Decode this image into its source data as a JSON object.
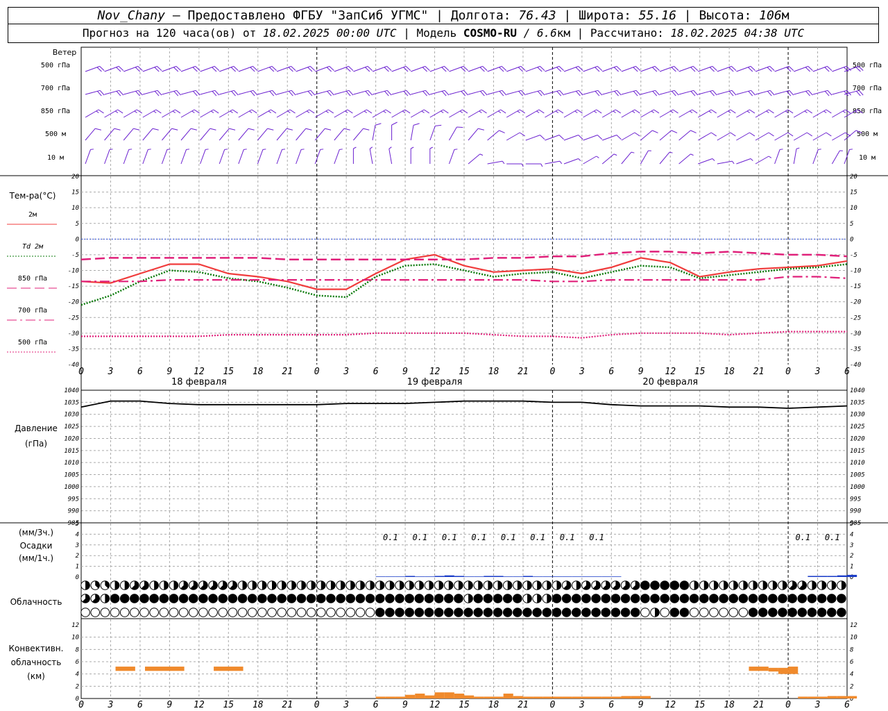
{
  "header": {
    "station": "Nov_Chany",
    "sep1": " — ",
    "provider": "Предоставлено ФГБУ \"ЗапСиб УГМС\"",
    "sep2": " | ",
    "lon_label": "Долгота: ",
    "lon_value": "76.43",
    "lat_label": "Широта: ",
    "lat_value": "55.16",
    "alt_label": "Высота: ",
    "alt_value": "106",
    "alt_unit": "м"
  },
  "subheader": {
    "forecast_label": "Прогноз на 120 часа(ов) от ",
    "forecast_start": "18.02.2025 00:00 UTC",
    "model_label": " | Модель ",
    "model_name": "COSMO-RU",
    "model_res": " / 6.6",
    "model_unit": "км",
    "calc_label": " | Рассчитано: ",
    "calc_time": "18.02.2025 04:38 UTC"
  },
  "colors": {
    "wind": "#6a1fd0",
    "t2m": "#f03c3c",
    "td2m": "#0a7a0a",
    "p850": "#e0207a",
    "p700": "#e0207a",
    "p500": "#e0207a",
    "zero_line": "#3050e0",
    "pressure": "#000000",
    "precip": "#1a3cc8",
    "convective": "#f08a2c",
    "grid": "#aaaaaa"
  },
  "chart_data": [
    {
      "type": "wind-barbs",
      "panel_label": "Ветер",
      "levels": [
        "500 гПа",
        "700 гПа",
        "850 гПа",
        "500  м",
        "10   м"
      ],
      "rows": [
        {
          "spd": 20,
          "dir": [
            250,
            250,
            250,
            250,
            250,
            250,
            250,
            250,
            250,
            250,
            250,
            250,
            250,
            250,
            250,
            250,
            250,
            250,
            250,
            250,
            250,
            250,
            250,
            250,
            250,
            250,
            250,
            250,
            250,
            250,
            250,
            250,
            250,
            250,
            250,
            250,
            250,
            250,
            250,
            250,
            250
          ]
        },
        {
          "spd": 20,
          "dir": [
            255,
            255,
            255,
            255,
            255,
            255,
            255,
            255,
            255,
            255,
            255,
            255,
            255,
            255,
            255,
            255,
            255,
            255,
            255,
            255,
            255,
            255,
            255,
            255,
            255,
            255,
            255,
            255,
            255,
            255,
            255,
            255,
            255,
            255,
            255,
            255,
            255,
            255,
            255,
            255,
            255
          ]
        },
        {
          "spd": 15,
          "dir": [
            240,
            240,
            240,
            240,
            240,
            240,
            240,
            240,
            240,
            240,
            240,
            240,
            240,
            240,
            240,
            240,
            240,
            240,
            240,
            240,
            240,
            240,
            240,
            240,
            240,
            240,
            240,
            240,
            240,
            240,
            240,
            240,
            240,
            240,
            240,
            240,
            240,
            240,
            240,
            240,
            240
          ]
        },
        {
          "spd": 10,
          "dir": [
            220,
            220,
            220,
            220,
            220,
            220,
            220,
            220,
            220,
            220,
            220,
            220,
            220,
            220,
            220,
            190,
            180,
            190,
            200,
            210,
            220,
            230,
            240,
            250,
            250,
            250,
            250,
            250,
            240,
            230,
            230,
            230,
            240,
            240,
            240,
            240,
            240,
            240,
            240,
            240,
            230
          ]
        },
        {
          "spd": 5,
          "dir": [
            200,
            200,
            200,
            200,
            200,
            200,
            200,
            200,
            200,
            200,
            200,
            200,
            200,
            200,
            180,
            170,
            170,
            180,
            180,
            200,
            230,
            260,
            270,
            270,
            260,
            250,
            240,
            230,
            220,
            210,
            220,
            230,
            250,
            260,
            250,
            240,
            200,
            190,
            200,
            210,
            200
          ]
        }
      ]
    },
    {
      "type": "line",
      "ylabel": "Тем-ра(°С)",
      "ylim": [
        -40,
        20
      ],
      "x_unit": "hours",
      "x": [
        0,
        3,
        6,
        9,
        12,
        15,
        18,
        21,
        24,
        27,
        30,
        33,
        36,
        39,
        42,
        45,
        48,
        51,
        54,
        57,
        60,
        63,
        66,
        69,
        72,
        75,
        78
      ],
      "x_tick_labels": [
        "0",
        "3",
        "6",
        "9",
        "12",
        "15",
        "18",
        "21",
        "0",
        "3",
        "6",
        "9",
        "12",
        "15",
        "18",
        "21",
        "0",
        "3",
        "6",
        "9",
        "12",
        "15",
        "18",
        "21",
        "0",
        "3",
        "6"
      ],
      "date_labels": [
        "18 февраля",
        "19 февраля",
        "20 февраля"
      ],
      "date_label_x": [
        12,
        36,
        60
      ],
      "series": [
        {
          "name": "2м",
          "style": "solid",
          "values": [
            -13.5,
            -14,
            -11,
            -8,
            -8,
            -11,
            -12,
            -13.5,
            -16,
            -16,
            -11,
            -6.5,
            -5,
            -8.5,
            -10.5,
            -10,
            -9.5,
            -11,
            -9,
            -6,
            -7.5,
            -12,
            -10.5,
            -9.5,
            -9,
            -8.5,
            -7
          ]
        },
        {
          "name": "Td 2м",
          "style": "dotted",
          "values": [
            -21,
            -18,
            -13.5,
            -10,
            -10.5,
            -12.5,
            -13.5,
            -15.5,
            -18,
            -18.5,
            -12,
            -8.5,
            -8,
            -10,
            -12,
            -11,
            -10.5,
            -12.5,
            -10.5,
            -8.5,
            -9,
            -12.5,
            -11.5,
            -10.5,
            -9.5,
            -9,
            -8
          ]
        },
        {
          "name": "850 гПа",
          "style": "longdash",
          "values": [
            -6.5,
            -6,
            -6,
            -6,
            -6,
            -6,
            -6,
            -6.5,
            -6.5,
            -6.5,
            -6.5,
            -6.5,
            -6.5,
            -6.5,
            -6,
            -6,
            -5.5,
            -5.5,
            -4.5,
            -4,
            -4,
            -4.5,
            -4,
            -4.5,
            -5,
            -5,
            -5.5
          ]
        },
        {
          "name": "700 гПа",
          "style": "dashdot",
          "values": [
            -13.5,
            -13.5,
            -13.5,
            -13,
            -13,
            -13,
            -13,
            -13,
            -13,
            -13,
            -13,
            -13,
            -13,
            -13,
            -13,
            -13,
            -13.5,
            -13.5,
            -13,
            -13,
            -13,
            -13,
            -13,
            -13,
            -12,
            -12,
            -12.5
          ]
        },
        {
          "name": "500 гПа",
          "style": "dotted",
          "values": [
            -31,
            -31,
            -31,
            -31,
            -31,
            -30.5,
            -30.5,
            -30.5,
            -30.5,
            -30.5,
            -30,
            -30,
            -30,
            -30,
            -30.5,
            -31,
            -31,
            -31.5,
            -30.5,
            -30,
            -30,
            -30,
            -30.5,
            -30,
            -29.5,
            -29.5,
            -29.5
          ]
        }
      ]
    },
    {
      "type": "line",
      "ylabel": "Давление",
      "yunit": "(гПа)",
      "ylim": [
        985,
        1040
      ],
      "x": [
        0,
        3,
        6,
        9,
        12,
        15,
        18,
        21,
        24,
        27,
        30,
        33,
        36,
        39,
        42,
        45,
        48,
        51,
        54,
        57,
        60,
        63,
        66,
        69,
        72,
        75,
        78
      ],
      "series": [
        {
          "values": [
            1033,
            1035.5,
            1035.5,
            1034.5,
            1034,
            1034,
            1034,
            1034,
            1034,
            1034.5,
            1034.5,
            1034.5,
            1035,
            1035.5,
            1035.5,
            1035.5,
            1035,
            1035,
            1034,
            1033.5,
            1033.5,
            1033.5,
            1033,
            1033,
            1032.5,
            1033,
            1033.5
          ]
        }
      ]
    },
    {
      "type": "bar",
      "ylabel": "Осадки",
      "yunit_3h": "(мм/3ч.)",
      "yunit_1h": "(мм/1ч.)",
      "ylim": [
        0,
        5
      ],
      "bar_labels": [
        "0.1",
        "0.1",
        "0.1",
        "0.1",
        "0.1",
        "0.1",
        "0.1",
        "0.1",
        "0.1",
        "0.1"
      ],
      "bar_label_x": [
        31.5,
        34.5,
        37.5,
        40.5,
        43.5,
        46.5,
        49.5,
        52.5,
        73.5,
        76.5
      ],
      "hourly_x": [
        30,
        31,
        32,
        33,
        34,
        35,
        36,
        37,
        38,
        39,
        40,
        41,
        42,
        43,
        44,
        45,
        46,
        47,
        48,
        49,
        50,
        51,
        52,
        53,
        54,
        55,
        56,
        57,
        58,
        59,
        60,
        61,
        62,
        63,
        64,
        65,
        66,
        67,
        68,
        69,
        70,
        71,
        72,
        73,
        74,
        75,
        76,
        77,
        78
      ],
      "hourly_mm": [
        0.05,
        0.05,
        0.05,
        0.1,
        0.05,
        0.05,
        0.1,
        0.15,
        0.1,
        0.05,
        0.05,
        0.1,
        0.1,
        0.05,
        0.05,
        0.1,
        0.05,
        0.05,
        0.05,
        0.05,
        0.05,
        0.05,
        0.05,
        0.05,
        0.05,
        0,
        0,
        0,
        0,
        0,
        0,
        0,
        0,
        0,
        0,
        0,
        0,
        0,
        0,
        0,
        0,
        0,
        0,
        0,
        0.1,
        0.1,
        0.1,
        0.15,
        0.2
      ]
    },
    {
      "type": "table",
      "ylabel": "Облачность",
      "rows_note": "cloud cover in octas for high, middle, low layers per hour",
      "high": [
        4,
        3,
        3,
        4,
        4,
        5,
        5,
        4,
        4,
        4,
        5,
        5,
        5,
        5,
        5,
        5,
        4,
        4,
        4,
        4,
        4,
        4,
        4,
        4,
        4,
        4,
        4,
        4,
        4,
        4,
        4,
        4,
        4,
        4,
        4,
        4,
        4,
        4,
        4,
        4,
        4,
        4,
        4,
        4,
        4,
        4,
        4,
        4,
        4,
        5,
        4,
        5,
        5,
        5,
        5,
        5,
        5,
        8,
        8,
        8,
        8,
        8,
        4,
        4,
        4,
        4,
        4,
        4,
        4,
        4,
        4,
        4,
        5,
        5,
        4,
        4,
        4,
        4,
        4
      ],
      "middle": [
        5,
        5,
        4,
        8,
        8,
        8,
        8,
        8,
        8,
        8,
        8,
        8,
        8,
        8,
        8,
        8,
        8,
        8,
        8,
        8,
        8,
        8,
        8,
        8,
        8,
        8,
        8,
        8,
        8,
        8,
        8,
        8,
        8,
        8,
        8,
        8,
        8,
        8,
        8,
        4,
        8,
        8,
        8,
        8,
        8,
        4,
        4,
        4,
        8,
        8,
        8,
        8,
        8,
        8,
        8,
        8,
        8,
        8,
        8,
        8,
        8,
        8,
        8,
        8,
        8,
        8,
        8,
        8,
        8,
        8,
        8,
        8,
        8,
        8,
        8,
        8,
        8,
        8,
        8
      ],
      "low": [
        0,
        0,
        0,
        0,
        0,
        0,
        0,
        0,
        0,
        0,
        0,
        0,
        0,
        0,
        0,
        0,
        0,
        0,
        0,
        0,
        0,
        0,
        0,
        0,
        0,
        0,
        0,
        0,
        0,
        0,
        8,
        8,
        8,
        8,
        8,
        8,
        8,
        8,
        8,
        8,
        8,
        8,
        8,
        8,
        8,
        8,
        8,
        8,
        8,
        8,
        8,
        8,
        8,
        8,
        8,
        8,
        8,
        0,
        4,
        0,
        8,
        8,
        0,
        0,
        0,
        0,
        0,
        0,
        8,
        8,
        8,
        8,
        8,
        8,
        8,
        8,
        8,
        8,
        8
      ]
    },
    {
      "type": "bar",
      "ylabel": "Конвективн.",
      "ylabel2": "облачность",
      "yunit": "(км)",
      "ylim": [
        0,
        14
      ],
      "segments": [
        {
          "x0": 3.5,
          "x1": 5.5,
          "base": 4.5,
          "top": 5.2
        },
        {
          "x0": 6.5,
          "x1": 10.5,
          "base": 4.5,
          "top": 5.2
        },
        {
          "x0": 13.5,
          "x1": 16.5,
          "base": 4.5,
          "top": 5.2
        },
        {
          "x0": 68,
          "x1": 70,
          "base": 4.5,
          "top": 5.2
        },
        {
          "x0": 70,
          "x1": 71,
          "base": 4.4,
          "top": 5.0
        },
        {
          "x0": 71,
          "x1": 72,
          "base": 4,
          "top": 5.0
        },
        {
          "x0": 72,
          "x1": 73,
          "base": 4,
          "top": 5.2
        }
      ],
      "low_x": [
        30,
        31,
        32,
        33,
        34,
        35,
        36,
        37,
        38,
        39,
        40,
        41,
        42,
        43,
        44,
        45,
        46,
        47,
        48,
        49,
        50,
        51,
        52,
        53,
        54,
        55,
        56,
        57,
        58,
        59,
        60,
        61,
        62,
        63,
        64,
        65,
        66,
        67,
        68,
        69,
        70,
        71,
        72,
        73,
        74,
        75,
        76,
        77,
        78
      ],
      "low_km": [
        0.3,
        0.3,
        0.3,
        0.6,
        0.8,
        0.5,
        1,
        1,
        0.8,
        0.5,
        0.3,
        0.3,
        0.3,
        0.8,
        0.4,
        0.3,
        0.3,
        0.3,
        0.3,
        0.3,
        0.3,
        0.3,
        0.3,
        0.3,
        0.3,
        0.4,
        0.4,
        0.4,
        0,
        0,
        0,
        0,
        0,
        0,
        0,
        0,
        0,
        0,
        0,
        0,
        0,
        0,
        0,
        0.3,
        0.3,
        0.3,
        0.4,
        0.4,
        0.4
      ]
    }
  ]
}
